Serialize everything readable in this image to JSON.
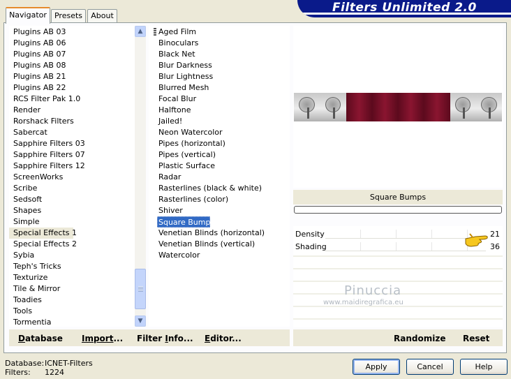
{
  "banner": {
    "title": "Filters Unlimited 2.0"
  },
  "tabs": [
    "Navigator",
    "Presets",
    "About"
  ],
  "categories": [
    "Plugins AB 03",
    "Plugins AB 06",
    "Plugins AB 07",
    "Plugins AB 08",
    "Plugins AB 21",
    "Plugins AB 22",
    "RCS Filter Pak 1.0",
    "Render",
    "Rorshack Filters",
    "Sabercat",
    "Sapphire Filters 03",
    "Sapphire Filters 07",
    "Sapphire Filters 12",
    "ScreenWorks",
    "Scribe",
    "Sedsoft",
    "Shapes",
    "Simple",
    "Special Effects 1",
    "Special Effects 2",
    "Sybia",
    "Teph's Tricks",
    "Texturize",
    "Tile & Mirror",
    "Toadies",
    "Tools",
    "Tormentia"
  ],
  "selected_category": "Special Effects 1",
  "filters": [
    "Aged Film",
    "Binoculars",
    "Black Net",
    "Blur Darkness",
    "Blur Lightness",
    "Blurred Mesh",
    "Focal Blur",
    "Halftone",
    "Jailed!",
    "Neon Watercolor",
    "Pipes (horizontal)",
    "Pipes (vertical)",
    "Plastic Surface",
    "Radar",
    "Rasterlines (black & white)",
    "Rasterlines (color)",
    "Shiver",
    "Square Bumps",
    "Venetian Blinds (horizontal)",
    "Venetian Blinds (vertical)",
    "Watercolor"
  ],
  "selected_filter": "Square Bumps",
  "preview": {
    "filter_name": "Square Bumps"
  },
  "params": [
    {
      "label": "Density",
      "value": "21"
    },
    {
      "label": "Shading",
      "value": "36"
    }
  ],
  "watermark": {
    "line1": "Pinuccia",
    "line2": "www.maidiregrafica.eu"
  },
  "actions": {
    "database": {
      "u": "D",
      "rest": "atabase"
    },
    "import": {
      "pre": "Import",
      "suffix": "..."
    },
    "filter_info": {
      "pre": "Filter ",
      "u": "I",
      "rest": "nfo..."
    },
    "editor": {
      "u": "E",
      "rest": "ditor..."
    },
    "randomize": "Randomize",
    "reset": "Reset"
  },
  "status": {
    "database_label": "Database:",
    "database_value": "ICNET-Filters",
    "filters_label": "Filters:",
    "filters_value": "1224"
  },
  "buttons": {
    "apply": "Apply",
    "cancel": "Cancel",
    "help": "Help"
  },
  "colors": {
    "banner": "#0a1a8a",
    "selection": "#316ac5",
    "accent_tab": "#e68b2c",
    "preview_red": "#8a1530"
  },
  "icons": {
    "scroll_up": "chevron-up-icon",
    "scroll_down": "chevron-down-icon",
    "pointer": "pointing-hand-icon"
  }
}
